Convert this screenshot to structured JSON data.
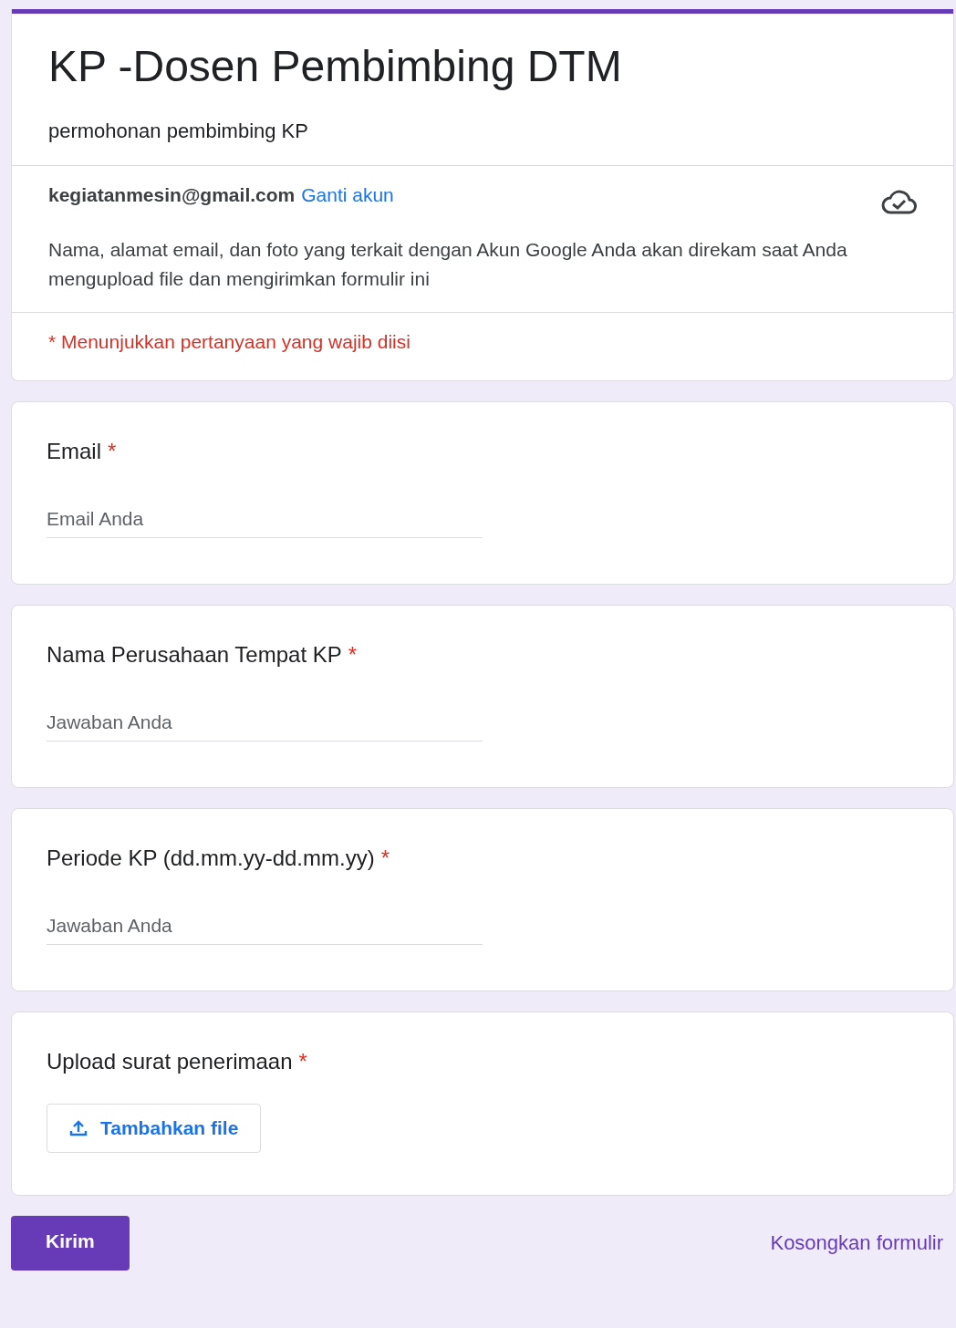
{
  "form": {
    "title": "KP -Dosen Pembimbing DTM",
    "description": "permohonan pembimbing KP",
    "account_email": "kegiatanmesin@gmail.com",
    "switch_account_link": "Ganti akun",
    "privacy_notice": "Nama, alamat email, dan foto yang terkait dengan Akun Google Anda akan direkam saat Anda mengupload file dan mengirimkan formulir ini",
    "required_notice": "* Menunjukkan pertanyaan yang wajib diisi"
  },
  "questions": [
    {
      "kind": "text",
      "label": "Email",
      "required_mark": "*",
      "placeholder": "Email Anda"
    },
    {
      "kind": "text",
      "label": "Nama Perusahaan Tempat KP",
      "required_mark": "*",
      "placeholder": "Jawaban Anda"
    },
    {
      "kind": "text",
      "label": "Periode KP (dd.mm.yy-dd.mm.yy)",
      "required_mark": "*",
      "placeholder": "Jawaban Anda"
    },
    {
      "kind": "file",
      "label": "Upload surat penerimaan",
      "required_mark": "*",
      "button": "Tambahkan file"
    }
  ],
  "actions": {
    "submit": "Kirim",
    "clear": "Kosongkan formulir"
  }
}
